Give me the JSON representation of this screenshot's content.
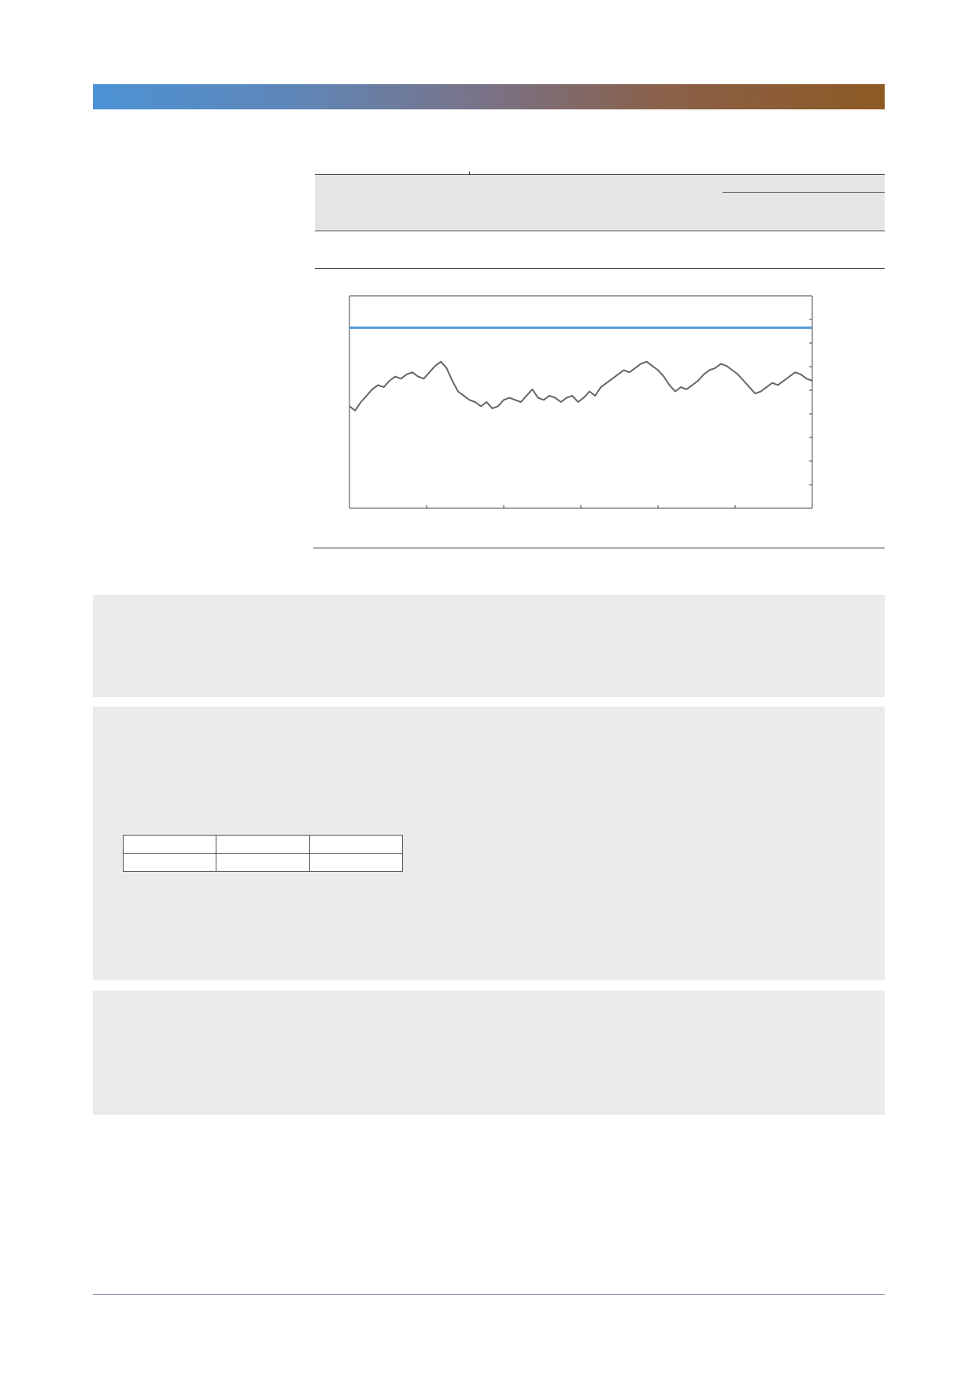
{
  "header": {
    "band_gradient": [
      "#4c92d4",
      "#7a7285",
      "#8d5a24"
    ]
  },
  "chart_data": {
    "type": "line",
    "series": [
      {
        "color": "#5b9bd5",
        "values": [
          0.85,
          0.85
        ]
      },
      {
        "color": "#666666",
        "values": [
          0.48,
          0.46,
          0.5,
          0.53,
          0.56,
          0.58,
          0.57,
          0.6,
          0.62,
          0.61,
          0.63,
          0.64,
          0.62,
          0.61,
          0.64,
          0.67,
          0.69,
          0.66,
          0.6,
          0.55,
          0.53,
          0.51,
          0.5,
          0.48,
          0.5,
          0.47,
          0.48,
          0.51,
          0.52,
          0.51,
          0.5,
          0.53,
          0.56,
          0.52,
          0.51,
          0.53,
          0.52,
          0.5,
          0.52,
          0.53,
          0.5,
          0.52,
          0.55,
          0.53,
          0.57,
          0.59,
          0.61,
          0.63,
          0.65,
          0.64,
          0.66,
          0.68,
          0.69,
          0.67,
          0.65,
          0.62,
          0.58,
          0.55,
          0.57,
          0.56,
          0.58,
          0.6,
          0.63,
          0.65,
          0.66,
          0.68,
          0.67,
          0.65,
          0.63,
          0.6,
          0.57,
          0.54,
          0.55,
          0.57,
          0.59,
          0.58,
          0.6,
          0.62,
          0.64,
          0.63,
          0.61,
          0.6
        ]
      }
    ],
    "x_ticks_count": 6,
    "y_ticks_count": 9,
    "grid": false
  },
  "mini_table": {
    "rows": [
      [
        "",
        "",
        ""
      ],
      [
        "",
        "",
        ""
      ]
    ]
  }
}
